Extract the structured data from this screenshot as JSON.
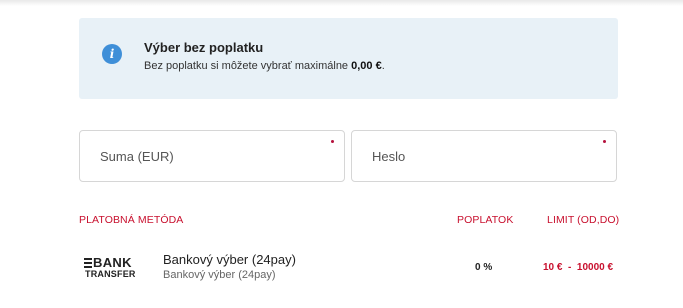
{
  "info": {
    "title": "Výber bez poplatku",
    "text_prefix": "Bez poplatku si môžete vybrať maximálne ",
    "amount": "0,00 €",
    "text_suffix": ".",
    "icon": "info-icon"
  },
  "form": {
    "amount_placeholder": "Suma (EUR)",
    "amount_value": "",
    "password_placeholder": "Heslo",
    "password_value": ""
  },
  "table": {
    "headers": {
      "method": "PLATOBNÁ METÓDA",
      "fee": "POPLATOK",
      "limit": "LIMIT (OD,DO)"
    },
    "rows": [
      {
        "logo_line1": "BANK",
        "logo_line2": "TRANSFER",
        "name": "Bankový výber (24pay)",
        "subtitle": "Bankový výber (24pay)",
        "fee": "0 %",
        "limit": "10 €  -  10000 €"
      }
    ]
  },
  "colors": {
    "accent": "#c8102e",
    "info_bg": "#e8f1f7",
    "info_icon": "#3f8fd8"
  }
}
